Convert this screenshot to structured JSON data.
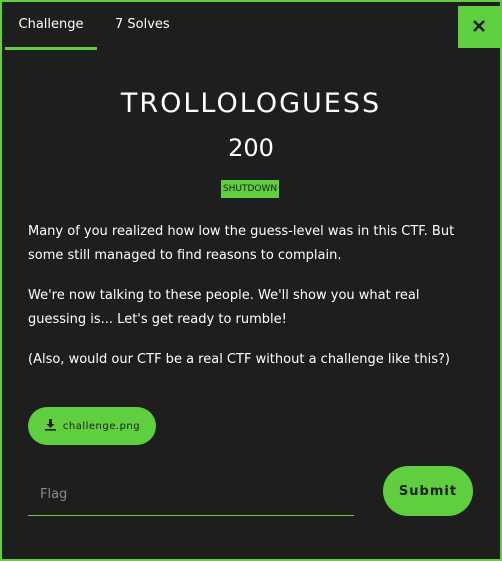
{
  "tabs": {
    "challenge_label": "Challenge",
    "solves_label": "7 Solves"
  },
  "close": {
    "icon": "close-icon",
    "glyph": "×"
  },
  "challenge": {
    "title": "TROLLOLOGUESS",
    "points": "200",
    "tag": "SHUTDOWN",
    "description": [
      "Many of you realized how low the guess-level was in this CTF. But some still managed to find reasons to complain.",
      "We're now talking to these people. We'll show you what real guessing is... Let's get ready to rumble!",
      "(Also, would our CTF be a real CTF without a challenge like this?)"
    ]
  },
  "download": {
    "icon": "download-icon",
    "filename": "challenge.png"
  },
  "flag": {
    "placeholder": "Flag",
    "value": ""
  },
  "submit": {
    "label": "Submit"
  },
  "colors": {
    "accent": "#5fcf3f",
    "background": "#1e1e1e",
    "text": "#ffffff"
  }
}
